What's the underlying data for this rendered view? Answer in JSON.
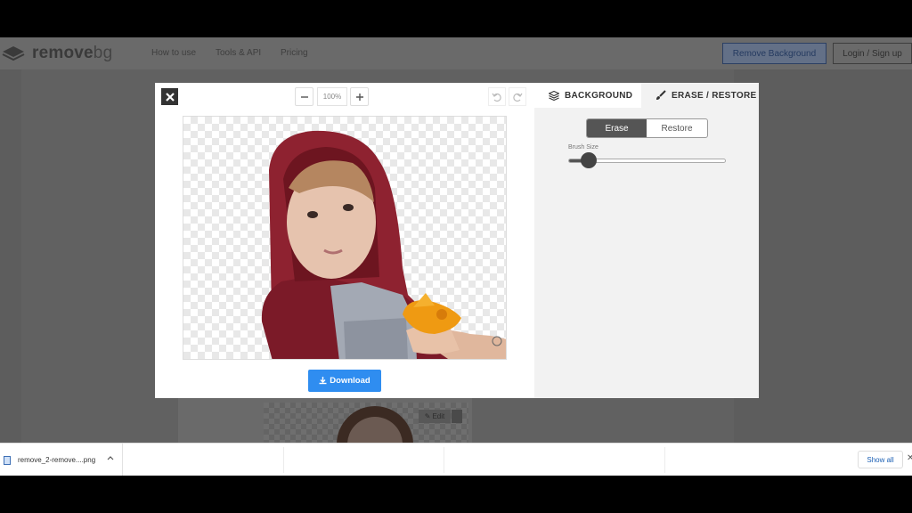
{
  "site": {
    "logo_bold": "remove",
    "logo_light": "bg",
    "nav": [
      "How to use",
      "Tools & API",
      "Pricing"
    ],
    "remove_bg_button": "Remove Background",
    "login_button": "Login / Sign up",
    "edit_label": "Edit"
  },
  "editor": {
    "zoom_value": "100%",
    "download_label": "Download",
    "tabs": {
      "background": "BACKGROUND",
      "erase_restore": "ERASE / RESTORE"
    },
    "mode": {
      "erase": "Erase",
      "restore": "Restore",
      "selected": "Erase"
    },
    "brush_size_label": "Brush Size",
    "brush_size_fraction": 0.13
  },
  "downloads": {
    "file_name": "remove_2-remove....png",
    "show_all": "Show all"
  },
  "colors": {
    "accent": "#2f8df0",
    "dark": "#333333",
    "panel_bg": "#f2f2f2"
  }
}
